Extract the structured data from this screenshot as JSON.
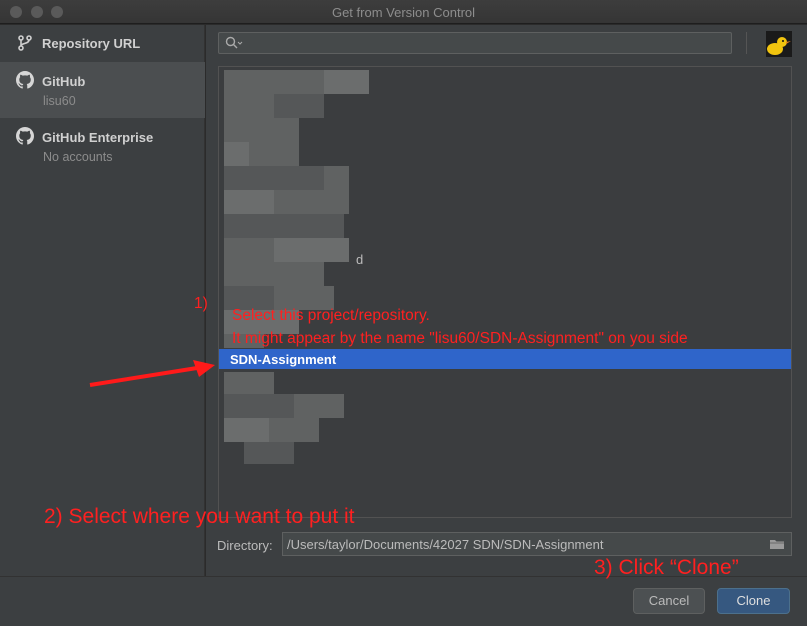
{
  "window": {
    "title": "Get from Version Control"
  },
  "sidebar": {
    "items": [
      {
        "label": "Repository URL",
        "icon": "branch-icon"
      },
      {
        "label": "GitHub",
        "sublabel": "lisu60",
        "icon": "github-icon",
        "selected": true
      },
      {
        "label": "GitHub Enterprise",
        "sublabel": "No accounts",
        "icon": "github-icon"
      }
    ]
  },
  "search": {
    "placeholder": "",
    "value": ""
  },
  "repo_list": {
    "selected_repo": "SDN-Assignment",
    "partial_text": "d"
  },
  "directory": {
    "label": "Directory:",
    "value": "/Users/taylor/Documents/42027 SDN/SDN-Assignment"
  },
  "buttons": {
    "cancel": "Cancel",
    "clone": "Clone"
  },
  "annotations": {
    "step1_number": "1)",
    "step1_line1": "Select this project/repository.",
    "step1_line2": "It might appear by the name \"lisu60/SDN-Assignment\" on you side",
    "step2": "2) Select where you want to put it",
    "step3": "3) Click “Clone”"
  },
  "colors": {
    "selection": "#2f65ca",
    "annotation": "#ff2020",
    "primary_button": "#365880"
  }
}
